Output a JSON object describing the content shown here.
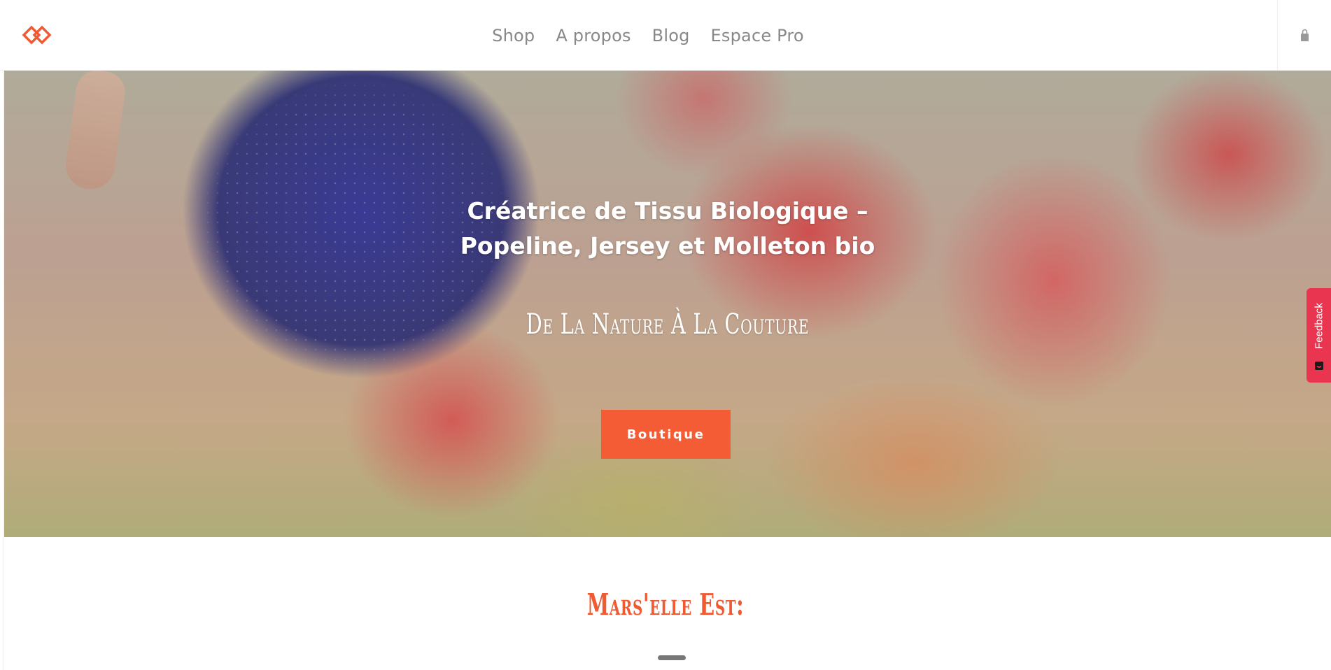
{
  "header": {
    "nav": [
      {
        "label": "Shop"
      },
      {
        "label": "A propos"
      },
      {
        "label": "Blog"
      },
      {
        "label": "Espace Pro"
      }
    ]
  },
  "hero": {
    "title_line1": "Créatrice de Tissu Biologique –",
    "title_line2": "Popeline, Jersey et Molleton bio",
    "tagline": "De La Nature À La Couture",
    "button_label": "Boutique"
  },
  "feedback": {
    "label": "Feedback"
  },
  "section": {
    "title": "Mars'elle Est:"
  },
  "colors": {
    "accent": "#f45c35",
    "feedback": "#e9354f",
    "nav_text": "#888888"
  }
}
